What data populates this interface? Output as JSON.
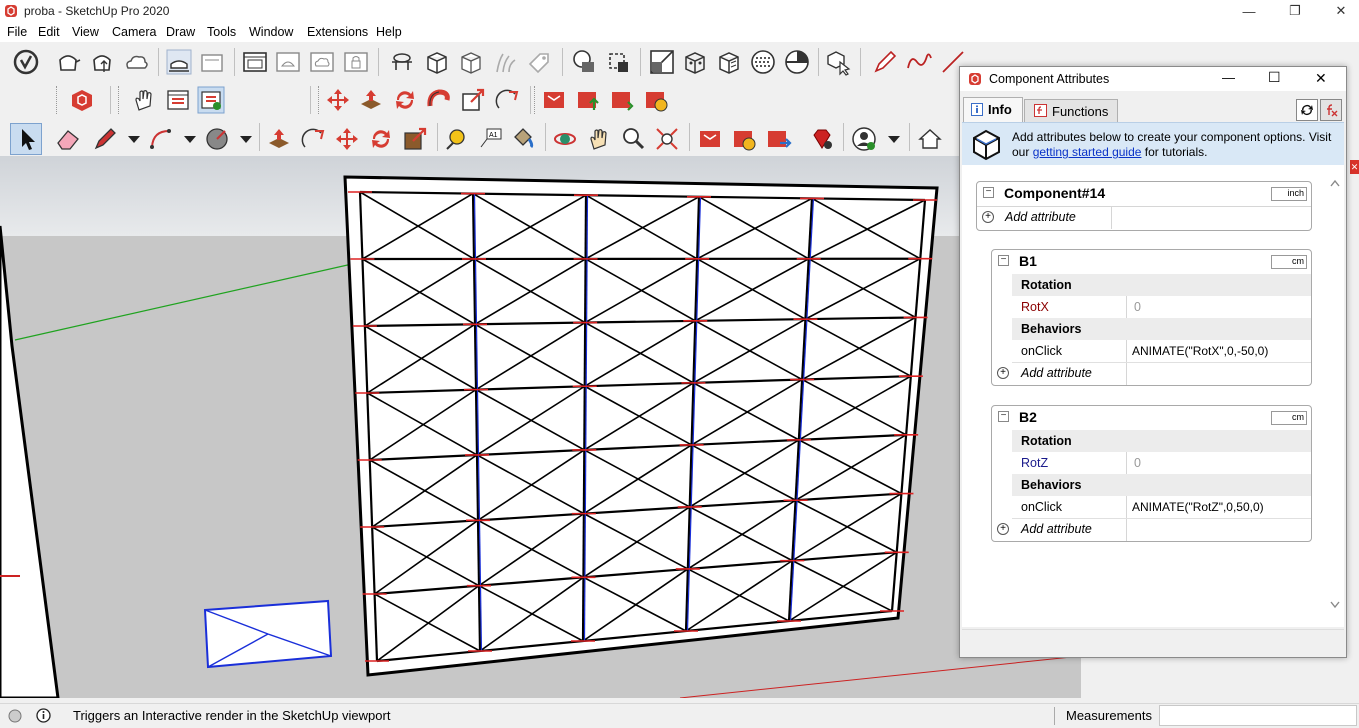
{
  "window": {
    "title": "proba - SketchUp Pro 2020",
    "minimize": "—",
    "restore": "❐",
    "close": "✕"
  },
  "menu": [
    "File",
    "Edit",
    "View",
    "Camera",
    "Draw",
    "Tools",
    "Window",
    "Extensions",
    "Help"
  ],
  "panel": {
    "title": "Component Attributes",
    "tabs": [
      {
        "label": "Info"
      },
      {
        "label": "Functions"
      }
    ],
    "info_text_1": "Add attributes below to create your component options. Visit",
    "info_text_2_prefix": "our ",
    "info_link": "getting started guide",
    "info_text_2_suffix": " for tutorials.",
    "minimize": "—",
    "maximize": "☐",
    "close": "✕",
    "components": [
      {
        "name": "Component#14",
        "unit": "inch",
        "add_label": "Add attribute"
      },
      {
        "name": "B1",
        "unit": "cm",
        "sections": [
          {
            "header": "Rotation",
            "rows": [
              {
                "key": "RotX",
                "value": "0"
              }
            ]
          },
          {
            "header": "Behaviors",
            "rows": [
              {
                "key": "onClick",
                "value": "ANIMATE(\"RotX\",0,-50,0)"
              }
            ]
          }
        ],
        "add_label": "Add attribute"
      },
      {
        "name": "B2",
        "unit": "cm",
        "sections": [
          {
            "header": "Rotation",
            "rows": [
              {
                "key": "RotZ",
                "value": "0"
              }
            ]
          },
          {
            "header": "Behaviors",
            "rows": [
              {
                "key": "onClick",
                "value": "ANIMATE(\"RotZ\",0,50,0)"
              }
            ]
          }
        ],
        "add_label": "Add attribute"
      }
    ]
  },
  "status": {
    "message": "Triggers an Interactive render in the SketchUp viewport",
    "measurements_label": "Measurements"
  },
  "colors": {
    "rotx_key": "#8b0000",
    "rotz_key": "#1a1a8b",
    "link": "#0b33c8",
    "section_header_bg": "#ececec"
  }
}
